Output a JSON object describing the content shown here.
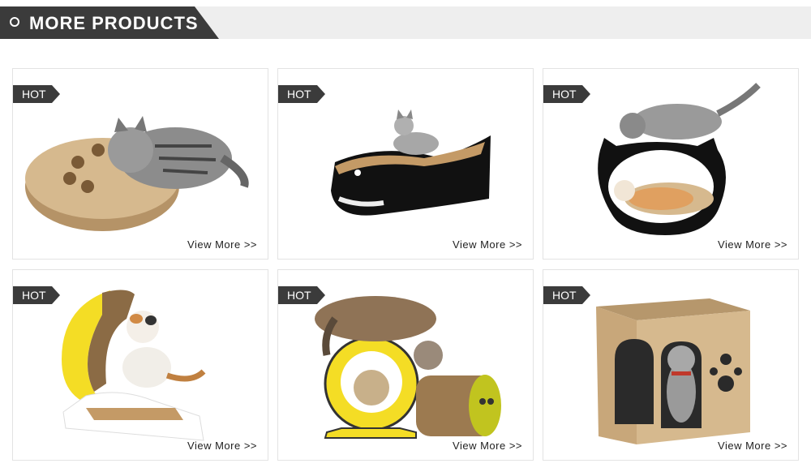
{
  "header": {
    "title": "MORE PRODUCTS"
  },
  "products": [
    {
      "badge": "HOT",
      "link": "View More >>"
    },
    {
      "badge": "HOT",
      "link": "View More >>"
    },
    {
      "badge": "HOT",
      "link": "View More >>"
    },
    {
      "badge": "HOT",
      "link": "View More >>"
    },
    {
      "badge": "HOT",
      "link": "View More >>"
    },
    {
      "badge": "HOT",
      "link": "View More >>"
    }
  ],
  "colors": {
    "header_dark": "#3b3b3b",
    "header_light": "#eeeeee",
    "cardboard": "#c8a77a",
    "yellow": "#f4dd25"
  }
}
